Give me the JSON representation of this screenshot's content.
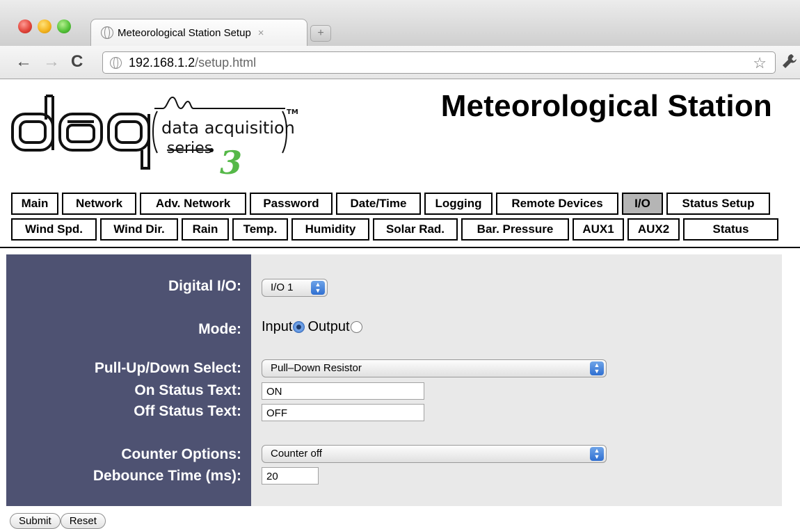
{
  "browser": {
    "tab_title": "Meteorological Station Setup",
    "tab_close": "×",
    "new_tab": "+",
    "url_host": "192.168.1.2",
    "url_path": "/setup.html",
    "back": "←",
    "forward": "→",
    "reload": "C",
    "star": "☆",
    "wrench": "🔧"
  },
  "logo": {
    "brand": "daq",
    "tagline_1": "data acquisition",
    "tagline_2": "series",
    "mark": "3",
    "tm": "TM"
  },
  "page_title": "Meteorological Station",
  "nav": {
    "row1": [
      {
        "label": "Main",
        "active": false
      },
      {
        "label": "Network",
        "active": false
      },
      {
        "label": "Adv. Network",
        "active": false
      },
      {
        "label": "Password",
        "active": false
      },
      {
        "label": "Date/Time",
        "active": false
      },
      {
        "label": "Logging",
        "active": false
      },
      {
        "label": "Remote Devices",
        "active": false
      },
      {
        "label": "I/O",
        "active": true
      },
      {
        "label": "Status Setup",
        "active": false
      }
    ],
    "row2": [
      {
        "label": "Wind Spd.",
        "active": false
      },
      {
        "label": "Wind Dir.",
        "active": false
      },
      {
        "label": "Rain",
        "active": false
      },
      {
        "label": "Temp.",
        "active": false
      },
      {
        "label": "Humidity",
        "active": false
      },
      {
        "label": "Solar Rad.",
        "active": false
      },
      {
        "label": "Bar. Pressure",
        "active": false
      },
      {
        "label": "AUX1",
        "active": false
      },
      {
        "label": "AUX2",
        "active": false
      },
      {
        "label": "Status",
        "active": false
      }
    ]
  },
  "form": {
    "digital_io": {
      "label": "Digital I/O:",
      "value": "I/O 1"
    },
    "mode": {
      "label": "Mode:",
      "input_label": "Input",
      "output_label": "Output",
      "selected": "Input"
    },
    "pull": {
      "label": "Pull-Up/Down Select:",
      "value": "Pull–Down Resistor"
    },
    "on_status": {
      "label": "On Status Text:",
      "value": "ON"
    },
    "off_status": {
      "label": "Off Status Text:",
      "value": "OFF"
    },
    "counter": {
      "label": "Counter Options:",
      "value": "Counter off"
    },
    "debounce": {
      "label": "Debounce Time (ms):",
      "value": "20"
    }
  },
  "buttons": {
    "submit": "Submit",
    "reset": "Reset"
  },
  "colors": {
    "label_bg": "#4e5272",
    "value_bg": "#e9e9e9",
    "active_tab": "#b5b5b5",
    "logo_green": "#55b848"
  }
}
